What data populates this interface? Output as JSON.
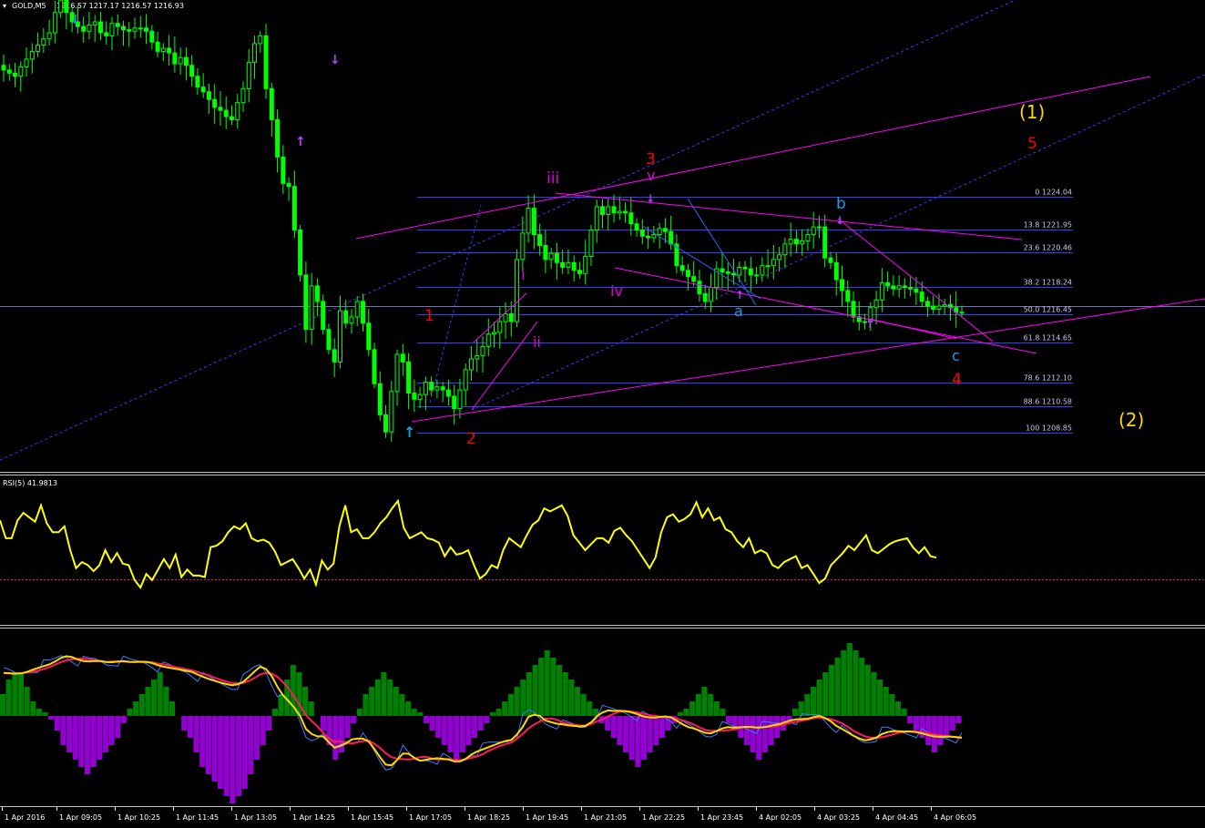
{
  "header": {
    "symbol_text": "GOLD,M5",
    "ohlc_text": "1216.57 1217.17 1216.57 1216.93"
  },
  "rsi_panel": {
    "label": "RSI(5) 41.9813",
    "line_color": "#ffff00",
    "level_color": "#ff0080"
  },
  "colors": {
    "background": "#000000",
    "candles": "#00ff00",
    "wave_lines": "#ff00ff",
    "channel_lines": "#4040ff",
    "fib_lines": "#4040ff",
    "red_labels": "#ff0000",
    "magenta_labels": "#dd00dd",
    "cyan_labels": "#1e9be8",
    "yellow_labels": "#ffd700",
    "hist_pos": "#008000",
    "hist_neg": "#9400d3"
  },
  "time_axis": [
    "1 Apr 2016",
    "1 Apr 09:05",
    "1 Apr 10:25",
    "1 Apr 11:45",
    "1 Apr 13:05",
    "1 Apr 14:25",
    "1 Apr 15:45",
    "1 Apr 17:05",
    "1 Apr 18:25",
    "1 Apr 19:45",
    "1 Apr 21:05",
    "1 Apr 22:25",
    "1 Apr 23:45",
    "4 Apr 02:05",
    "4 Apr 03:25",
    "4 Apr 04:45",
    "4 Apr 06:05"
  ],
  "fib_levels": [
    {
      "label": "0 1224.04",
      "price": 1224.04
    },
    {
      "label": "13.8 1221.95",
      "price": 1221.95
    },
    {
      "label": "23.6 1220.46",
      "price": 1220.46
    },
    {
      "label": "38.2 1218.24",
      "price": 1218.24
    },
    {
      "label": "50.0 1216.45",
      "price": 1216.45
    },
    {
      "label": "61.8 1214.65",
      "price": 1214.65
    },
    {
      "label": "78.6 1212.10",
      "price": 1212.1
    },
    {
      "label": "88.6 1210.58",
      "price": 1210.58
    },
    {
      "label": "100 1208.85",
      "price": 1208.85
    }
  ],
  "wave_labels": {
    "w1": "1",
    "w2": "2",
    "w3": "3",
    "w4": "4",
    "w5": "5",
    "wi": "i",
    "wii": "ii",
    "wiii": "iii",
    "wiv": "iv",
    "wv": "v",
    "wa": "a",
    "wb": "b",
    "wc": "c",
    "big1": "(1)",
    "big2": "(2)"
  },
  "chart_data": [
    {
      "type": "line",
      "series": [
        {
          "values": [
            1232.2,
            1232.0,
            1231.8,
            1232.4,
            1232.9,
            1233.4,
            1233.8,
            1234.2,
            1234.6,
            1235.9,
            1236.7,
            1235.9,
            1235.3,
            1235.0,
            1234.7,
            1235.1,
            1235.3,
            1234.6,
            1234.4,
            1235.2,
            1235.0,
            1234.8,
            1234.7,
            1234.9,
            1234.9,
            1234.7,
            1234.0,
            1233.4,
            1233.6,
            1233.3,
            1232.6,
            1233.0,
            1232.5,
            1231.8,
            1231.1,
            1230.8,
            1230.3,
            1229.8,
            1229.6,
            1229.2,
            1229.0,
            1230.1,
            1231.0,
            1232.7,
            1233.9,
            1234.4,
            1231.0,
            1229.0,
            1226.6,
            1224.9,
            1224.7,
            1221.9,
            1219.0,
            1215.5,
            1218.3,
            1217.3,
            1215.5,
            1214.2,
            1213.4,
            1216.7,
            1215.9,
            1216.3,
            1217.3,
            1215.9,
            1214.2,
            1212.0,
            1210.0,
            1208.9,
            1211.5,
            1213.9,
            1213.4,
            1211.4,
            1211.0,
            1211.3,
            1212.1,
            1211.6,
            1211.8,
            1211.6,
            1211.2,
            1210.4,
            1211.6,
            1212.9,
            1213.6,
            1213.8,
            1214.4,
            1215.2,
            1215.3,
            1216.0,
            1216.5,
            1216.0,
            1220.0,
            1221.7,
            1223.3,
            1221.6,
            1220.9,
            1220.0,
            1220.4,
            1219.8,
            1219.5,
            1219.8,
            1219.3,
            1219.1,
            1220.2,
            1221.9,
            1223.4,
            1222.9,
            1223.4,
            1223.0,
            1223.1,
            1223.0,
            1222.3,
            1221.9,
            1221.5,
            1221.4,
            1221.6,
            1222.0,
            1221.8,
            1221.0,
            1219.6,
            1219.3,
            1218.9,
            1218.6,
            1217.8,
            1217.3,
            1218.2,
            1219.4,
            1219.2,
            1219.1,
            1219.0,
            1219.5,
            1219.4,
            1219.0,
            1219.0,
            1219.6,
            1219.6,
            1220.0,
            1220.3,
            1221.0,
            1221.3,
            1221.0,
            1221.2,
            1221.6,
            1222.1,
            1222.1,
            1220.1,
            1219.8,
            1218.7,
            1218.0,
            1217.3,
            1216.3,
            1216.0,
            1216.0,
            1216.9,
            1217.4,
            1218.5,
            1218.3,
            1218.1,
            1218.3,
            1218.2,
            1218.1,
            1217.9,
            1217.3,
            1217.0,
            1216.8,
            1217.0,
            1217.1,
            1216.9,
            1216.6,
            1216.6
          ]
        }
      ],
      "ylim": [
        1205,
        1240
      ]
    },
    {
      "type": "line",
      "series": [
        {
          "values": [
            70,
            58,
            58,
            70,
            75,
            72,
            69,
            80,
            68,
            62,
            62,
            66,
            50,
            38,
            42,
            40,
            36,
            40,
            50,
            42,
            48,
            41,
            40,
            30,
            25,
            34,
            30,
            37,
            44,
            38,
            47,
            32,
            37,
            33,
            33,
            32,
            52,
            53,
            56,
            62,
            66,
            64,
            68,
            58,
            56,
            57,
            55,
            49,
            40,
            42,
            44,
            38,
            31,
            37,
            27,
            43,
            37,
            41,
            66,
            80,
            62,
            64,
            58,
            58,
            62,
            68,
            72,
            78,
            83,
            65,
            58,
            60,
            62,
            58,
            57,
            55,
            46,
            52,
            47,
            48,
            50,
            40,
            31,
            34,
            40,
            38,
            50,
            58,
            55,
            52,
            60,
            67,
            70,
            78,
            76,
            78,
            80,
            73,
            60,
            55,
            50,
            54,
            58,
            58,
            55,
            63,
            65,
            60,
            56,
            50,
            44,
            38,
            45,
            62,
            72,
            74,
            69,
            71,
            74,
            82,
            72,
            78,
            70,
            72,
            64,
            62,
            56,
            52,
            58,
            48,
            50,
            48,
            40,
            38,
            42,
            44,
            46,
            38,
            40,
            34,
            28,
            31,
            40,
            44,
            48,
            53,
            50,
            55,
            60,
            50,
            48,
            51,
            54,
            56,
            57,
            58,
            52,
            48,
            52,
            46,
            45
          ]
        }
      ]
    },
    {
      "type": "bar",
      "series": [
        {
          "values": [
            3,
            5,
            6,
            6,
            4,
            2,
            1,
            0.5,
            -0.5,
            -2,
            -4,
            -5,
            -6,
            -7,
            -8,
            -7,
            -6,
            -5,
            -4,
            -3,
            -1,
            1,
            2,
            3,
            4,
            5,
            6,
            4,
            2,
            0,
            -2,
            -3,
            -5,
            -7,
            -8,
            -9,
            -10,
            -11,
            -12,
            -11,
            -10,
            -8,
            -6,
            -4,
            -2,
            1,
            3,
            5,
            7,
            6,
            4,
            2,
            0,
            -2,
            -4,
            -6,
            -5,
            -3,
            -1,
            1,
            3,
            4,
            5,
            6,
            5,
            4,
            3,
            2,
            1,
            0.5,
            -1,
            -2,
            -3,
            -4,
            -5,
            -6,
            -5,
            -4,
            -3,
            -2,
            -1,
            0.5,
            1,
            2,
            3,
            4,
            5,
            6,
            7,
            8,
            9,
            8,
            7,
            6,
            5,
            4,
            3,
            2,
            1,
            -1,
            -2,
            -3,
            -4,
            -5,
            -6,
            -7,
            -6,
            -5,
            -4,
            -3,
            -2,
            -1,
            0.5,
            1,
            2,
            3,
            4,
            3,
            2,
            1,
            -1,
            -2,
            -3,
            -4,
            -5,
            -6,
            -5,
            -4,
            -3,
            -2,
            -1,
            1,
            2,
            3,
            4,
            5,
            6,
            7,
            8,
            9,
            10,
            9,
            8,
            7,
            6,
            5,
            4,
            3,
            2,
            1,
            -1,
            -2,
            -3,
            -4,
            -5,
            -4,
            -3,
            -2,
            -1
          ]
        }
      ]
    }
  ]
}
